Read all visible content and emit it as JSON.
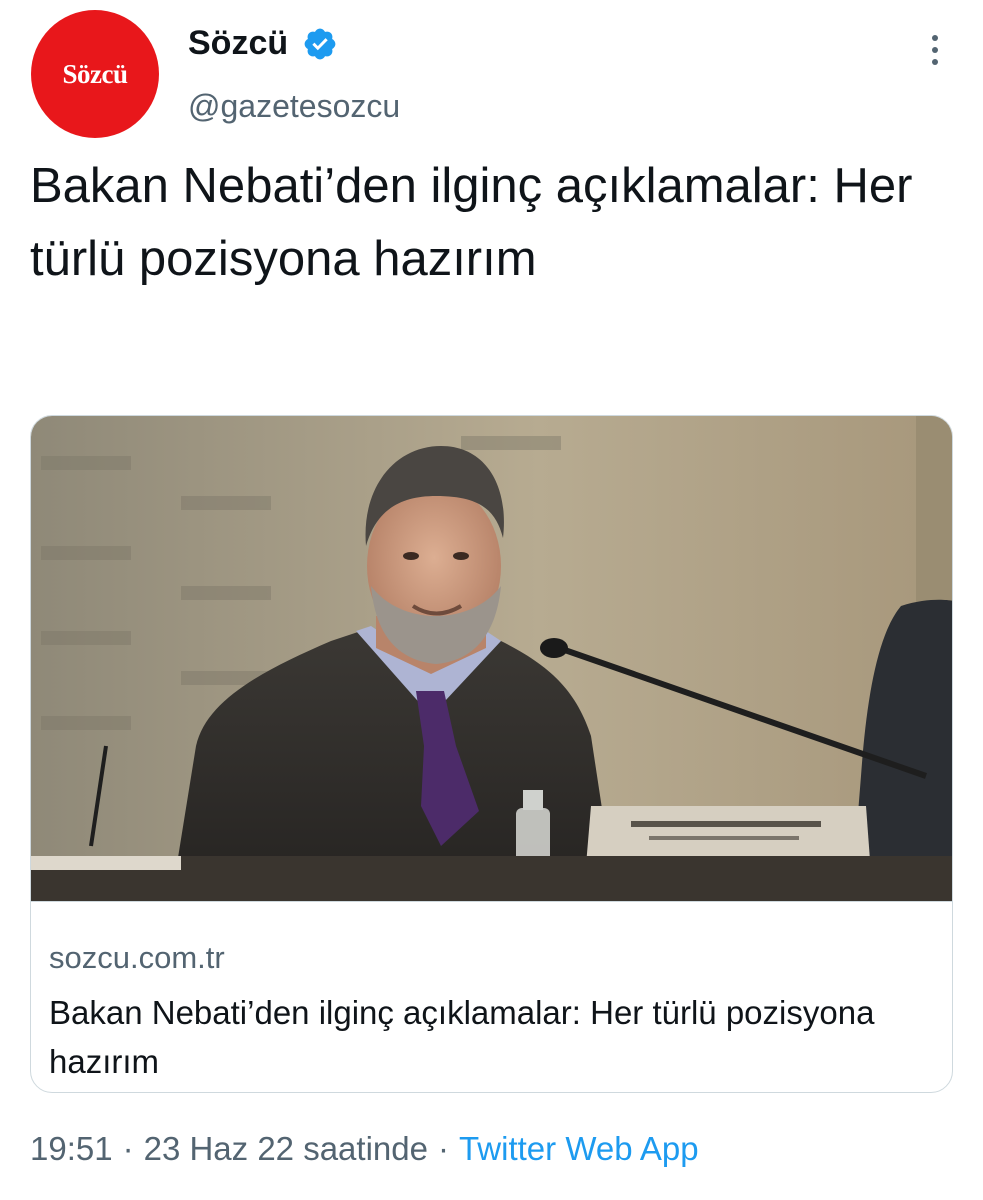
{
  "author": {
    "avatar_text": "Sözcü",
    "display_name": "Sözcü",
    "handle": "@gazetesozcu",
    "verified": true,
    "avatar_color": "#e8171b"
  },
  "tweet": {
    "text": "Bakan Nebati’den ilginç açıklamalar: Her türlü pozisyona hazırım"
  },
  "card": {
    "image_icon": "photo-of-man-at-press-conference",
    "domain": "sozcu.com.tr",
    "title": "Bakan Nebati’den ilginç açıklamalar: Her türlü pozisyona hazırım"
  },
  "meta": {
    "time": "19:51",
    "date": "23 Haz 22 saatinde",
    "separator": "·",
    "source": "Twitter Web App"
  },
  "colors": {
    "accent": "#1d9bf0",
    "secondary_text": "#536471",
    "border": "#cfd9de"
  }
}
